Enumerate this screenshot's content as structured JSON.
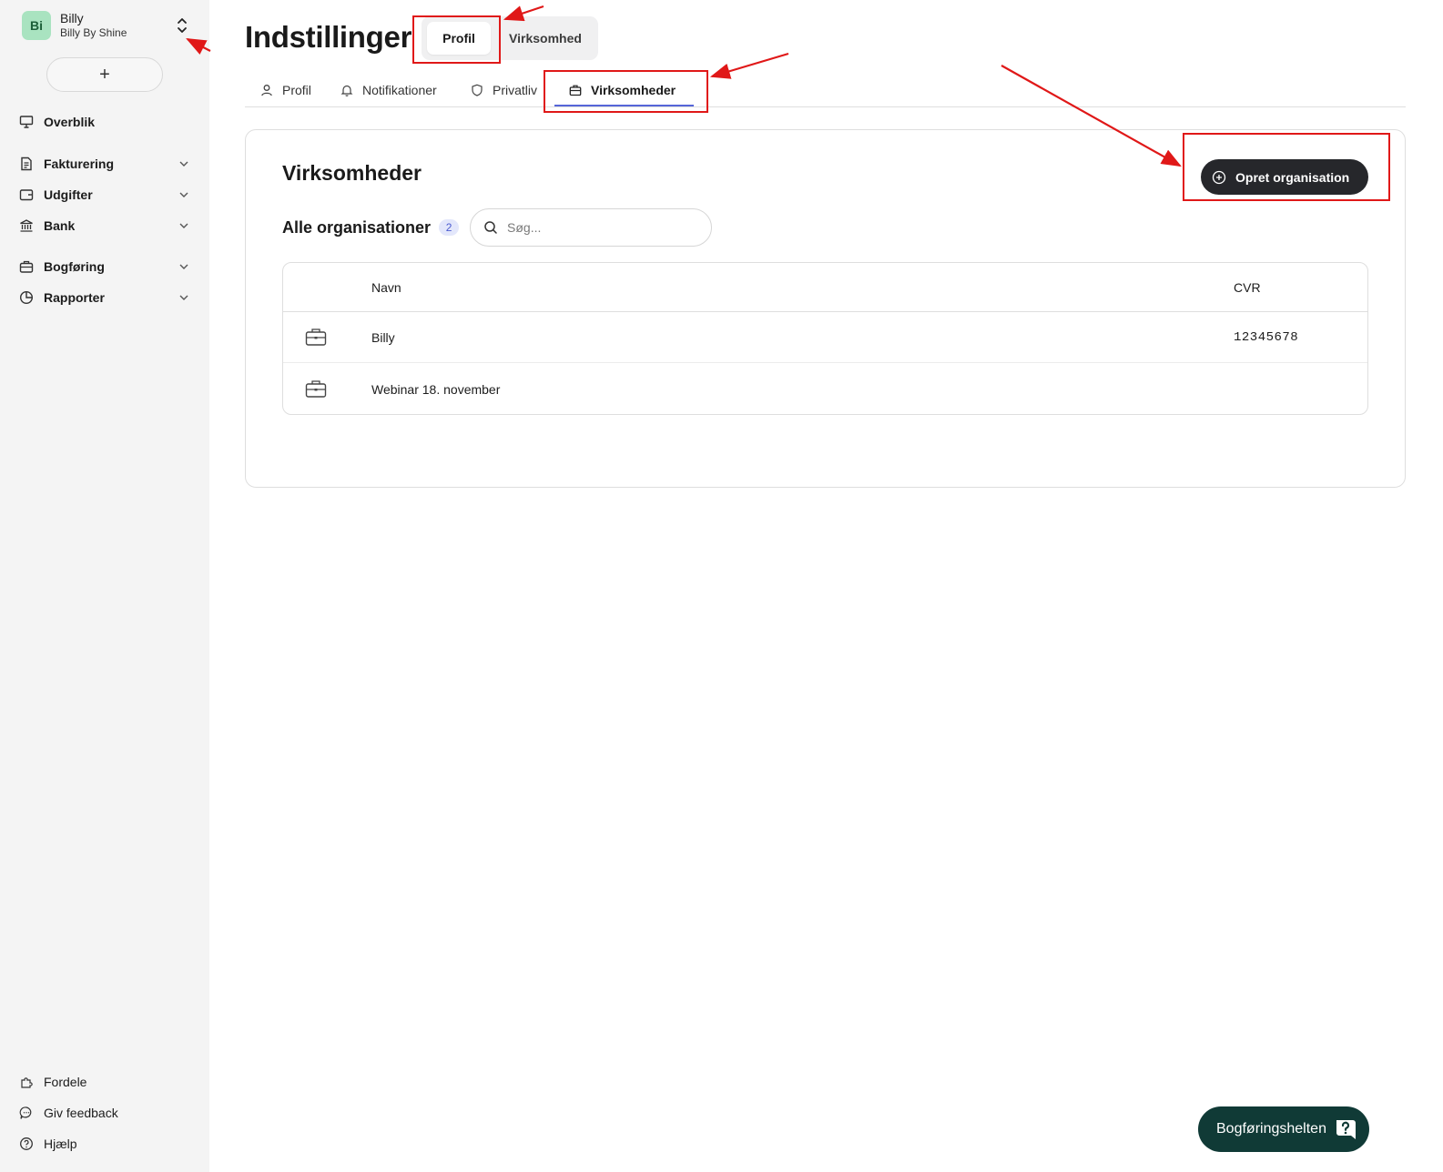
{
  "sidebar": {
    "org": {
      "initials": "Bi",
      "name": "Billy",
      "subtitle": "Billy By Shine"
    },
    "add_label": "+",
    "nav": [
      {
        "label": "Overblik",
        "icon": "presentation-icon"
      },
      {
        "label": "Fakturering",
        "icon": "invoice-icon"
      },
      {
        "label": "Udgifter",
        "icon": "wallet-icon"
      },
      {
        "label": "Bank",
        "icon": "bank-icon"
      },
      {
        "label": "Bogføring",
        "icon": "briefcase-icon"
      },
      {
        "label": "Rapporter",
        "icon": "pie-chart-icon"
      }
    ],
    "footer": [
      {
        "label": "Fordele",
        "icon": "puzzle-icon"
      },
      {
        "label": "Giv feedback",
        "icon": "chat-icon"
      },
      {
        "label": "Hjælp",
        "icon": "help-icon"
      }
    ]
  },
  "header": {
    "title": "Indstillinger",
    "segments": [
      {
        "label": "Profil",
        "active": true
      },
      {
        "label": "Virksomhed",
        "active": false
      }
    ]
  },
  "tabs": [
    {
      "label": "Profil",
      "icon": "user-icon"
    },
    {
      "label": "Notifikationer",
      "icon": "bell-icon"
    },
    {
      "label": "Privatliv",
      "icon": "shield-icon"
    },
    {
      "label": "Virksomheder",
      "icon": "briefcase-icon",
      "active": true
    }
  ],
  "panel": {
    "title": "Virksomheder",
    "create_label": "Opret organisation",
    "list_title": "Alle organisationer",
    "count": "2",
    "search_placeholder": "Søg...",
    "columns": {
      "name": "Navn",
      "cvr": "CVR"
    },
    "rows": [
      {
        "name": "Billy",
        "cvr": "12345678"
      },
      {
        "name": "Webinar 18. november",
        "cvr": ""
      }
    ]
  },
  "help_widget": {
    "label": "Bogføringshelten"
  },
  "colors": {
    "accent": "#5565d8",
    "primary_button": "#26272b",
    "help_widget": "#103a36",
    "annotation": "#e01818"
  }
}
